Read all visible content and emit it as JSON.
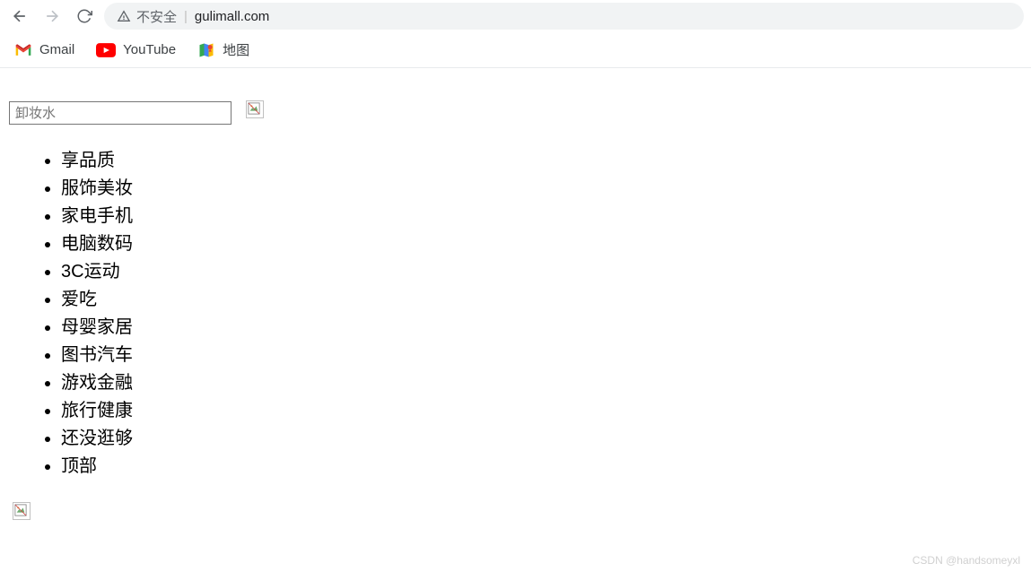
{
  "browser": {
    "security_label": "不安全",
    "url": "gulimall.com"
  },
  "bookmarks": [
    {
      "label": "Gmail",
      "icon": "gmail-icon"
    },
    {
      "label": "YouTube",
      "icon": "youtube-icon"
    },
    {
      "label": "地图",
      "icon": "maps-icon"
    }
  ],
  "search": {
    "placeholder": "卸妆水"
  },
  "categories": [
    "享品质",
    "服饰美妆",
    "家电手机",
    "电脑数码",
    "3C运动",
    "爱吃",
    "母婴家居",
    "图书汽车",
    "游戏金融",
    "旅行健康",
    "还没逛够",
    "顶部"
  ],
  "watermark": "CSDN @handsomeyxl"
}
